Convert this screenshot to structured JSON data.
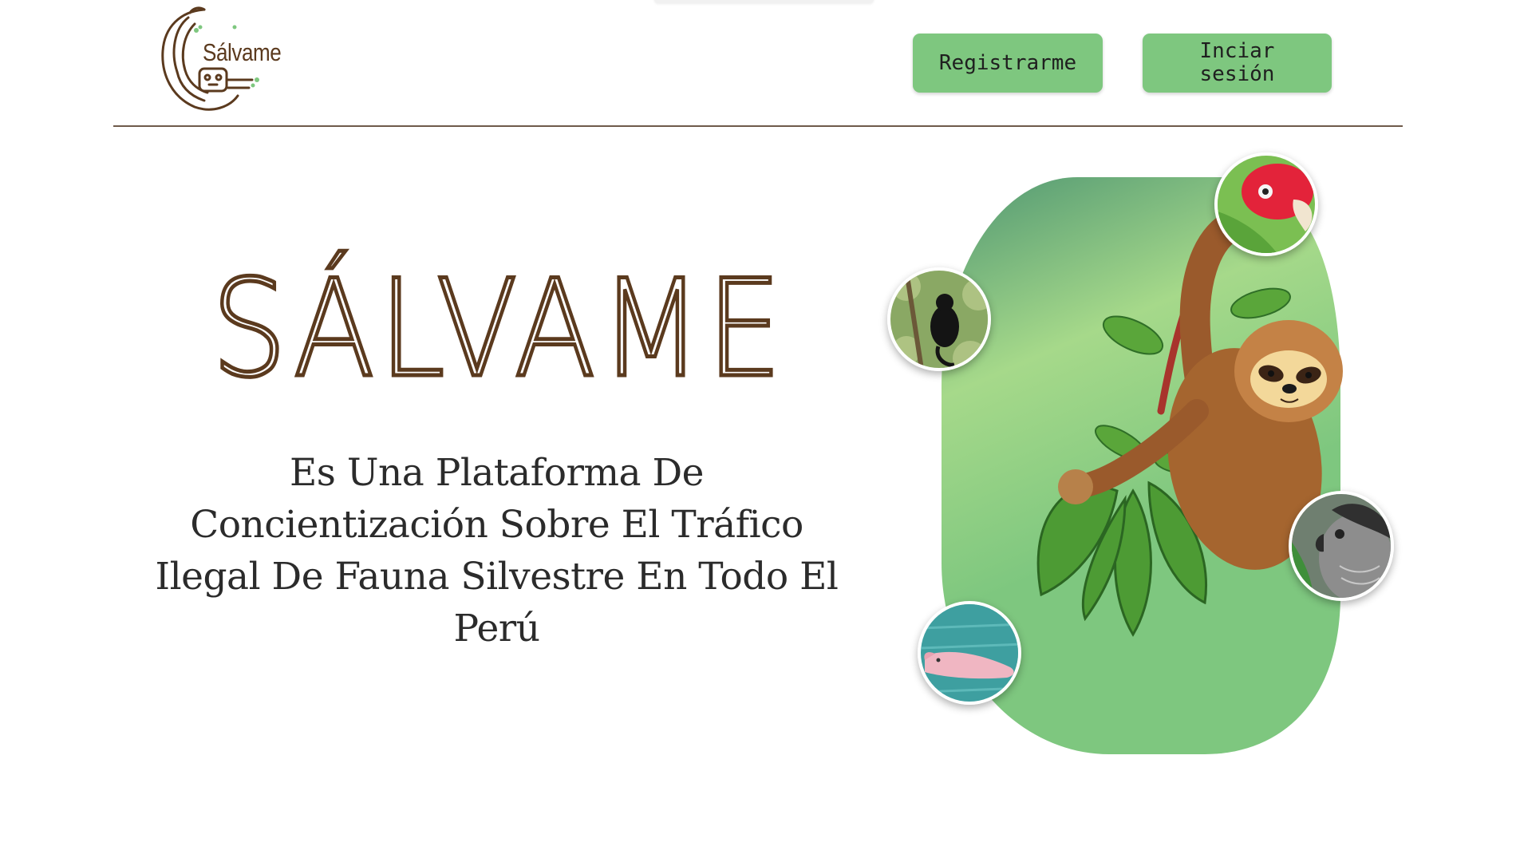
{
  "header": {
    "logo_text": "Sálvame",
    "register_label": "Registrarme",
    "login_label": "Inciar sesión"
  },
  "hero": {
    "title": "SÁLVAME",
    "subtitle": "Es Una Plataforma De Concientización Sobre El Tráfico Ilegal De Fauna Silvestre En Todo El Perú"
  },
  "illustration": {
    "main": "sloth-illustration",
    "bubbles": [
      "parrot-photo",
      "monkey-photo",
      "harpy-eagle-photo",
      "pink-dolphin-photo"
    ]
  },
  "colors": {
    "accent_green": "#7ec77f",
    "brand_brown": "#5b3a1e",
    "divider": "#6e5a4a"
  }
}
